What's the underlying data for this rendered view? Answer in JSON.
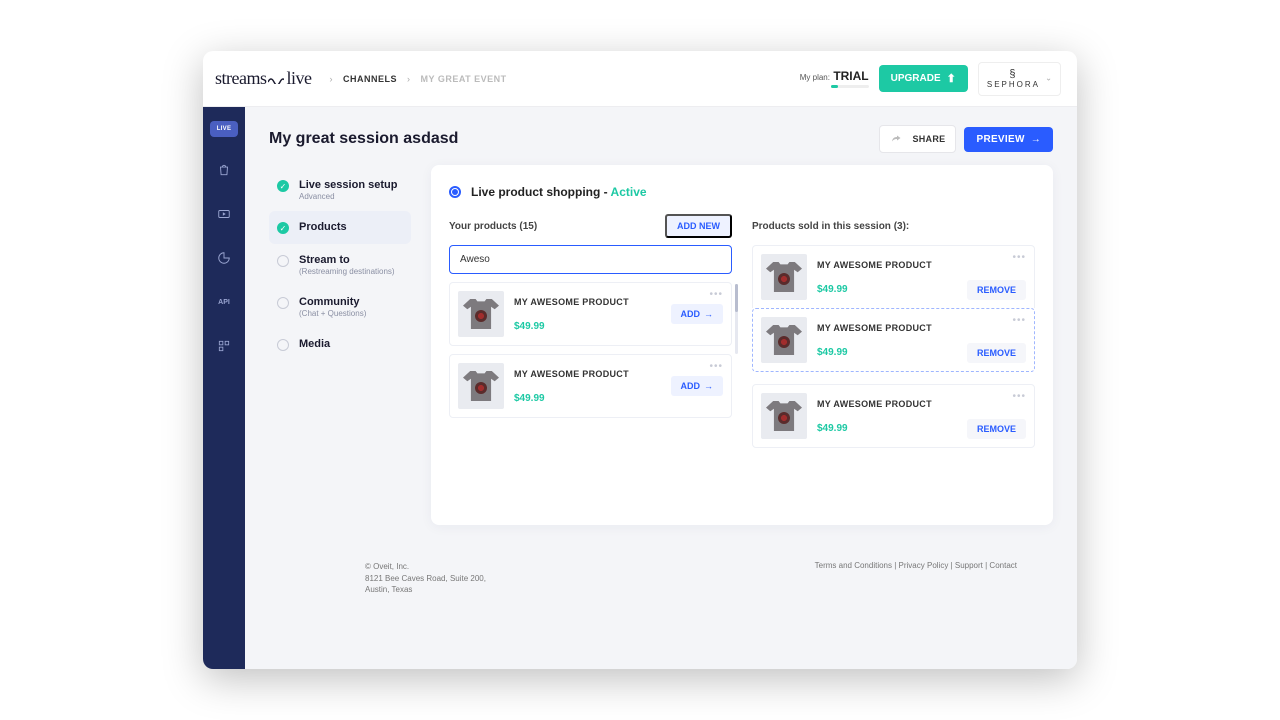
{
  "header": {
    "brand": "streams",
    "brand_suffix": "live",
    "crumbs": {
      "channels": "CHANNELS",
      "event": "MY GREAT EVENT"
    },
    "plan": {
      "label": "My plan:",
      "value": "TRIAL"
    },
    "upgrade": "UPGRADE",
    "account_brand": "SEPHORA"
  },
  "rail": {
    "live": "LIVE"
  },
  "page": {
    "title": "My great session asdasd",
    "share": "SHARE",
    "preview": "PREVIEW"
  },
  "steps": {
    "setup": {
      "label": "Live session setup",
      "sub": "Advanced"
    },
    "products": {
      "label": "Products"
    },
    "stream": {
      "label": "Stream to",
      "sub": "(Restreaming destinations)"
    },
    "community": {
      "label": "Community",
      "sub": "(Chat + Questions)"
    },
    "media": {
      "label": "Media"
    }
  },
  "card": {
    "title": "Live product shopping - ",
    "status": "Active",
    "left_head": "Your products (15)",
    "add_new": "ADD NEW",
    "search_value": "Aweso",
    "right_head": "Products sold in this session (3):",
    "product_name": "MY AWESOME PRODUCT",
    "price": "$49.99",
    "add": "ADD",
    "remove": "REMOVE"
  },
  "footer": {
    "company": "© Oveit, Inc.",
    "addr1": "8121 Bee Caves Road, Suite 200,",
    "addr2": "Austin, Texas",
    "links": {
      "terms": "Terms and Conditions",
      "privacy": "Privacy Policy",
      "support": "Support",
      "contact": "Contact"
    }
  }
}
